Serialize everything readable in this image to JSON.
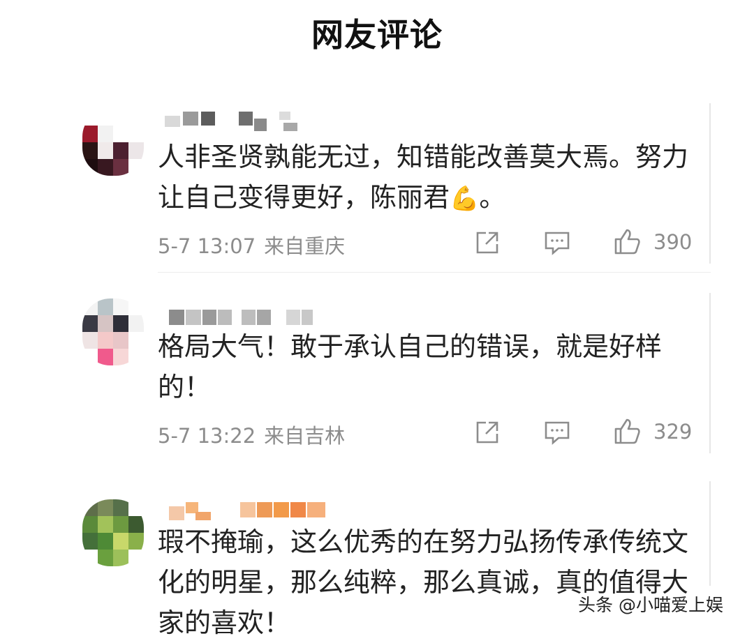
{
  "header": {
    "title": "网友评论"
  },
  "comments": [
    {
      "text": "人非圣贤孰能无过，知错能改善莫大焉。努力让自己变得更好，陈丽君",
      "emoji": "💪",
      "text_tail": "。",
      "time": "5-7 13:07",
      "location": "来自重庆",
      "likes": "390",
      "icons": [
        "share-icon",
        "comment-icon",
        "like-icon"
      ]
    },
    {
      "text": "格局大气！敢于承认自己的错误，就是好样的！",
      "time": "5-7 13:22",
      "location": "来自吉林",
      "likes": "329",
      "icons": [
        "share-icon",
        "comment-icon",
        "like-icon"
      ]
    },
    {
      "text": "瑕不掩瑜，这么优秀的在努力弘扬传承传统文化的明星，那么纯粹，那么真诚，真的值得大家的喜欢！"
    }
  ],
  "watermark": "头条 @小喵爱上娱",
  "colors": {
    "text": "#222222",
    "meta": "#8c8c8c",
    "divider": "#ececec"
  }
}
